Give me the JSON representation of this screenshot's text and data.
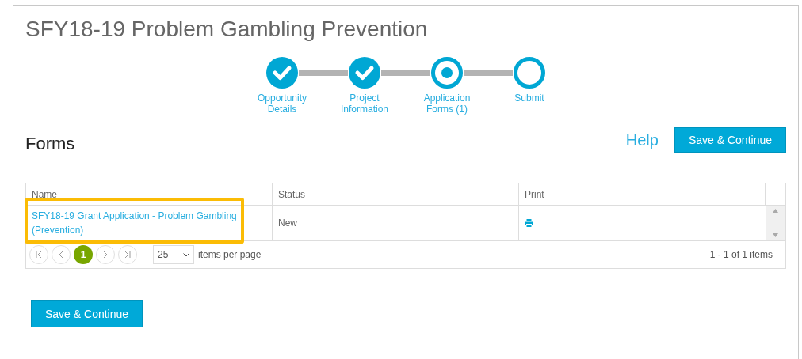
{
  "title": "SFY18-19 Problem Gambling Prevention",
  "steps": [
    {
      "label": "Opportunity Details",
      "kind": "done"
    },
    {
      "label": "Project Information",
      "kind": "done"
    },
    {
      "label": "Application Forms (1)",
      "kind": "current"
    },
    {
      "label": "Submit",
      "kind": "todo"
    }
  ],
  "section_title": "Forms",
  "help": "Help",
  "save_button": "Save & Continue",
  "table": {
    "columns": [
      "Name",
      "Status",
      "Print"
    ],
    "rows": [
      {
        "name": "SFY18-19 Grant Application - Problem Gambling (Prevention)",
        "status": "New",
        "highlighted": true
      }
    ]
  },
  "pager": {
    "pages": [
      {
        "label": "1",
        "selected": true
      }
    ],
    "page_size": "25",
    "page_size_label": "items per page",
    "summary": "1 - 1 of 1 items"
  },
  "bottom_button": "Save & Continue"
}
